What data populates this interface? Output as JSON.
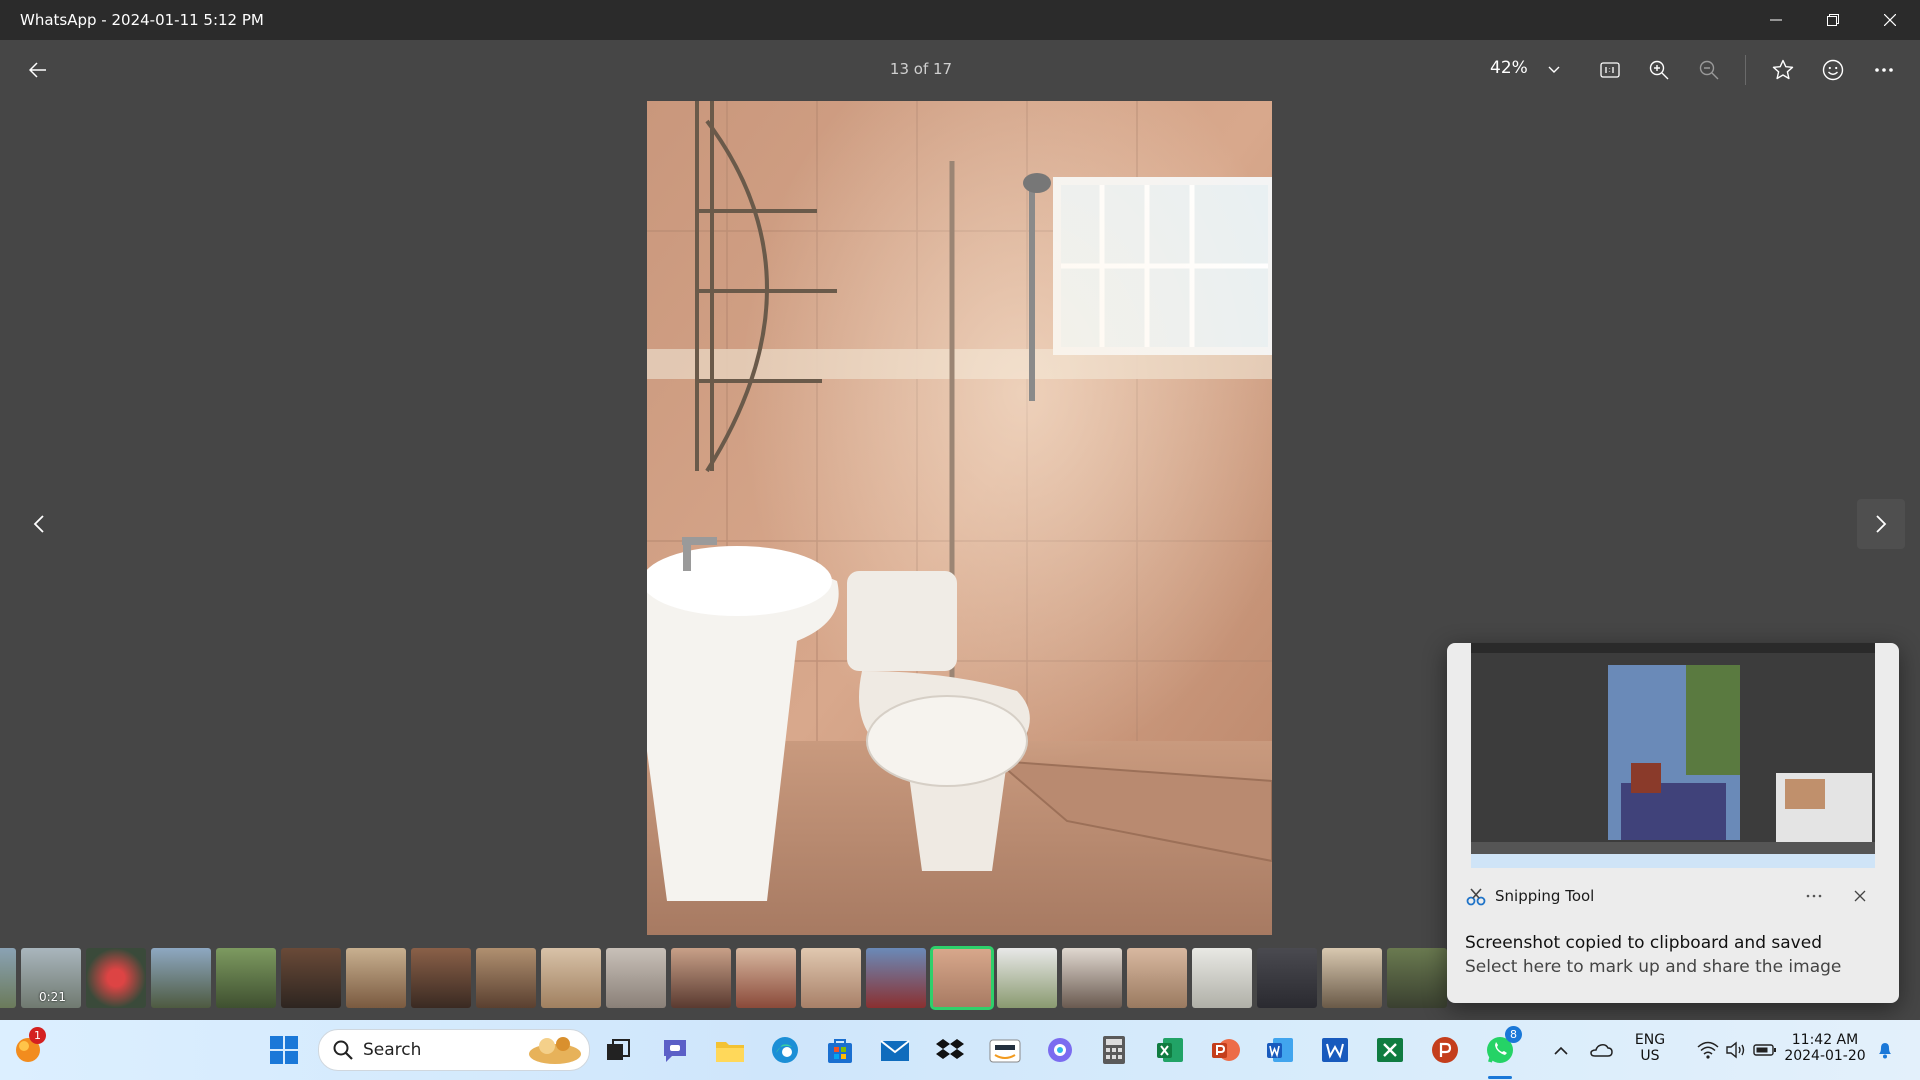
{
  "window": {
    "title": "WhatsApp - 2024-01-11 5:12 PM"
  },
  "toolbar": {
    "counter": "13 of 17",
    "zoom": "42%"
  },
  "filmstrip": {
    "video_duration": "0:21",
    "selected_index": 15
  },
  "toast": {
    "app_name": "Snipping Tool",
    "title": "Screenshot copied to clipboard and saved",
    "subtitle": "Select here to mark up and share the image"
  },
  "taskbar": {
    "search_placeholder": "Search",
    "widgets_badge": "1",
    "whatsapp_badge": "8",
    "language_line1": "ENG",
    "language_line2": "US",
    "clock_time": "11:42 AM",
    "clock_date": "2024-01-20"
  },
  "colors": {
    "accent_selected": "#2ed06b",
    "titlebar": "#2b2b2b",
    "viewer_bg": "#464646"
  }
}
